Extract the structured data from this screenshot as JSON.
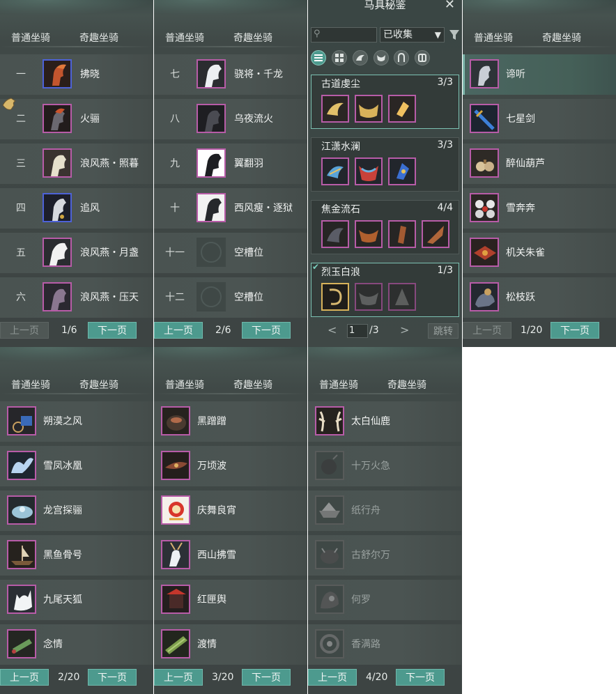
{
  "tabs": {
    "normal": "普通坐骑",
    "fun": "奇趣坐骑"
  },
  "pager": {
    "prev": "上一页",
    "next": "下一页"
  },
  "panels": [
    {
      "page": "1/6",
      "prev_disabled": true,
      "rows": [
        {
          "num": "一",
          "name": "拂晓"
        },
        {
          "num": "二",
          "name": "火骊"
        },
        {
          "num": "三",
          "name": "浪风燕・照暮"
        },
        {
          "num": "四",
          "name": "追风"
        },
        {
          "num": "五",
          "name": "浪风燕・月盏"
        },
        {
          "num": "六",
          "name": "浪风燕・压天"
        }
      ]
    },
    {
      "page": "2/6",
      "prev_disabled": false,
      "rows": [
        {
          "num": "七",
          "name": "骁将・千龙"
        },
        {
          "num": "八",
          "name": "乌夜流火"
        },
        {
          "num": "九",
          "name": "翼翻羽"
        },
        {
          "num": "十",
          "name": "西风瘦・逐狱"
        },
        {
          "num": "十一",
          "name": "空槽位"
        },
        {
          "num": "十二",
          "name": "空槽位"
        }
      ]
    },
    {
      "page": "1/20",
      "prev_disabled": true,
      "rows": [
        {
          "name": "谛听"
        },
        {
          "name": "七星剑"
        },
        {
          "name": "醉仙葫芦"
        },
        {
          "name": "雪奔奔"
        },
        {
          "name": "机关朱雀"
        },
        {
          "name": "松枝跃"
        }
      ]
    },
    {
      "page": "2/20",
      "prev_disabled": false,
      "rows": [
        {
          "name": "朔漠之风"
        },
        {
          "name": "雪凤冰凰"
        },
        {
          "name": "龙宫探骊"
        },
        {
          "name": "黑鱼骨号"
        },
        {
          "name": "九尾天狐"
        },
        {
          "name": "念情"
        }
      ]
    },
    {
      "page": "3/20",
      "prev_disabled": false,
      "rows": [
        {
          "name": "黑蹭蹭"
        },
        {
          "name": "万顷波"
        },
        {
          "name": "庆舞良宵"
        },
        {
          "name": "西山拂雪"
        },
        {
          "name": "红匣舆"
        },
        {
          "name": "渡情"
        }
      ]
    },
    {
      "page": "4/20",
      "prev_disabled": false,
      "rows": [
        {
          "name": "太白仙鹿"
        },
        {
          "name": "十万火急"
        },
        {
          "name": "纸行舟"
        },
        {
          "name": "古舒尔万"
        },
        {
          "name": "何罗"
        },
        {
          "name": "香满路"
        }
      ]
    }
  ],
  "dialog": {
    "title": "马具秘鉴",
    "close_icon": "close-icon",
    "filter_value": "已收集",
    "sets": [
      {
        "name": "古道虔尘",
        "count": "3/3"
      },
      {
        "name": "江潇水澜",
        "count": "3/3"
      },
      {
        "name": "焦金流石",
        "count": "4/4"
      },
      {
        "name": "烈玉白浪",
        "count": "1/3"
      }
    ],
    "page_current": "1",
    "page_total": "/3",
    "jump_label": "跳转"
  }
}
